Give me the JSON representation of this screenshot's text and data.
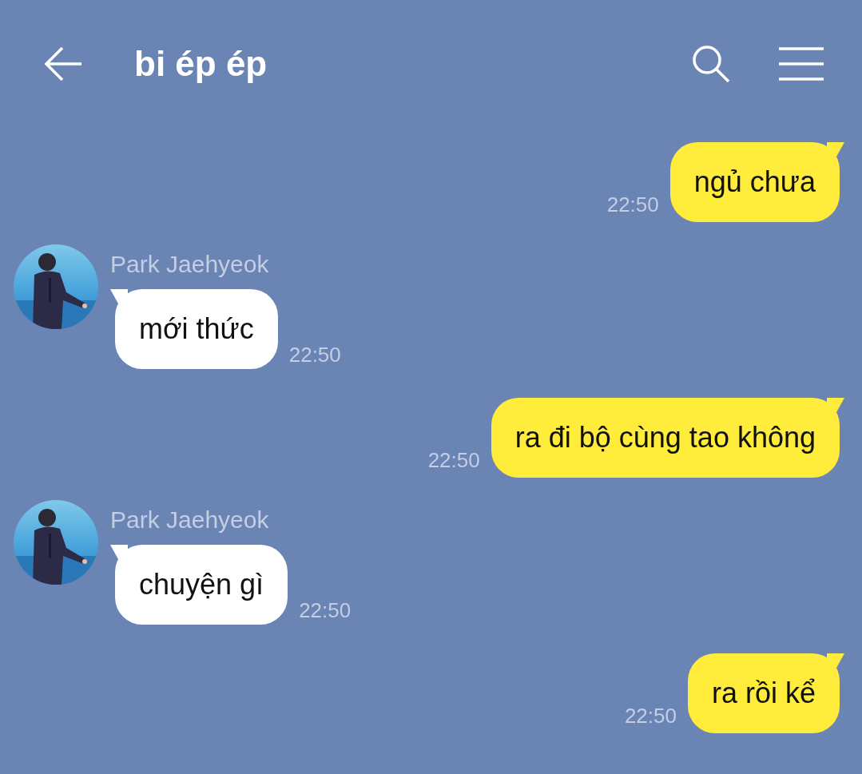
{
  "header": {
    "title": "bi ép ép"
  },
  "messages": [
    {
      "kind": "outgoing",
      "text": "ngủ chưa",
      "time": "22:50"
    },
    {
      "kind": "incoming",
      "sender": "Park Jaehyeok",
      "text": "mới thức",
      "time": "22:50"
    },
    {
      "kind": "outgoing",
      "text": "ra đi bộ cùng tao không",
      "time": "22:50"
    },
    {
      "kind": "incoming",
      "sender": "Park Jaehyeok",
      "text": "chuyện gì",
      "time": "22:50"
    },
    {
      "kind": "outgoing",
      "text": "ra rồi kể",
      "time": "22:50"
    }
  ]
}
